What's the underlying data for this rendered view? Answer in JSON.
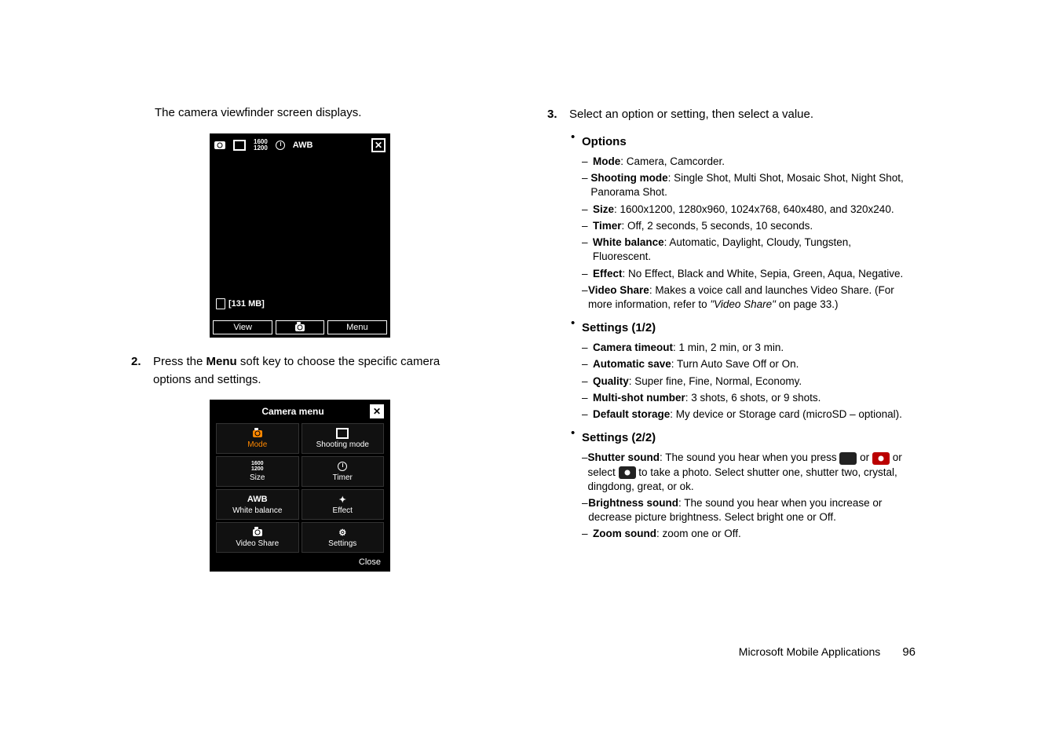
{
  "left": {
    "intro": "The camera viewfinder screen displays.",
    "fig1": {
      "top_size": "1600\n1200",
      "top_awb": "AWB",
      "mem": "[131 MB]",
      "btn_view": "View",
      "btn_menu": "Menu"
    },
    "step2_num": "2.",
    "step2_a": "Press the ",
    "step2_b": "Menu",
    "step2_c": " soft key to choose the specific camera options and settings.",
    "fig2": {
      "title": "Camera menu",
      "cells": {
        "mode": "Mode",
        "shooting": "Shooting mode",
        "size_icon": "1600\n1200",
        "size": "Size",
        "timer": "Timer",
        "wb_icon": "AWB",
        "wb": "White balance",
        "effect": "Effect",
        "vshare": "Video Share",
        "settings": "Settings"
      },
      "close": "Close"
    }
  },
  "right": {
    "step3_num": "3.",
    "step3_text": "Select an option or setting, then select a value.",
    "group1": "Options",
    "opt": {
      "mode": {
        "label": "Mode",
        "val": ": Camera, Camcorder."
      },
      "shoot": {
        "label": "Shooting mode",
        "val": ": Single Shot, Multi Shot, Mosaic Shot, Night Shot, Panorama Shot."
      },
      "size": {
        "label": "Size",
        "val": ": 1600x1200, 1280x960, 1024x768, 640x480, and 320x240."
      },
      "timer": {
        "label": "Timer",
        "val": ": Off, 2 seconds, 5 seconds, 10 seconds."
      },
      "wb": {
        "label": "White balance",
        "val": ": Automatic, Daylight, Cloudy, Tungsten, Fluorescent."
      },
      "effect": {
        "label": "Effect",
        "val": ": No Effect, Black and White, Sepia, Green, Aqua, Negative."
      },
      "vshare": {
        "label": "Video Share",
        "val1": ": Makes a voice call and launches Video Share. (For more information, refer to ",
        "ital": "\"Video Share\"",
        "val2": "  on page 33.)"
      }
    },
    "group2": "Settings (1/2)",
    "set1": {
      "timeout": {
        "label": "Camera timeout",
        "val": ": 1 min, 2 min, or 3 min."
      },
      "autosave": {
        "label": "Automatic save",
        "val": ": Turn Auto Save Off or On."
      },
      "quality": {
        "label": "Quality",
        "val": ": Super fine, Fine, Normal, Economy."
      },
      "multi": {
        "label": "Multi-shot number",
        "val": ": 3 shots, 6 shots, or 9 shots."
      },
      "storage": {
        "label": "Default storage",
        "val": ": My device or Storage card (microSD – optional)."
      }
    },
    "group3": "Settings (2/2)",
    "set2": {
      "shutter": {
        "label": "Shutter sound",
        "a": ": The sound you hear when you press ",
        "b": " or ",
        "c": " or select ",
        "d": " to take a photo. Select shutter one, shutter two, crystal, dingdong, great, or ok."
      },
      "bright": {
        "label": "Brightness sound",
        "val": ": The sound you hear when you increase or decrease picture brightness. Select bright one or Off."
      },
      "zoom": {
        "label": "Zoom sound",
        "val": ": zoom one or Off."
      }
    }
  },
  "footer": {
    "section": "Microsoft Mobile Applications",
    "page": "96"
  }
}
